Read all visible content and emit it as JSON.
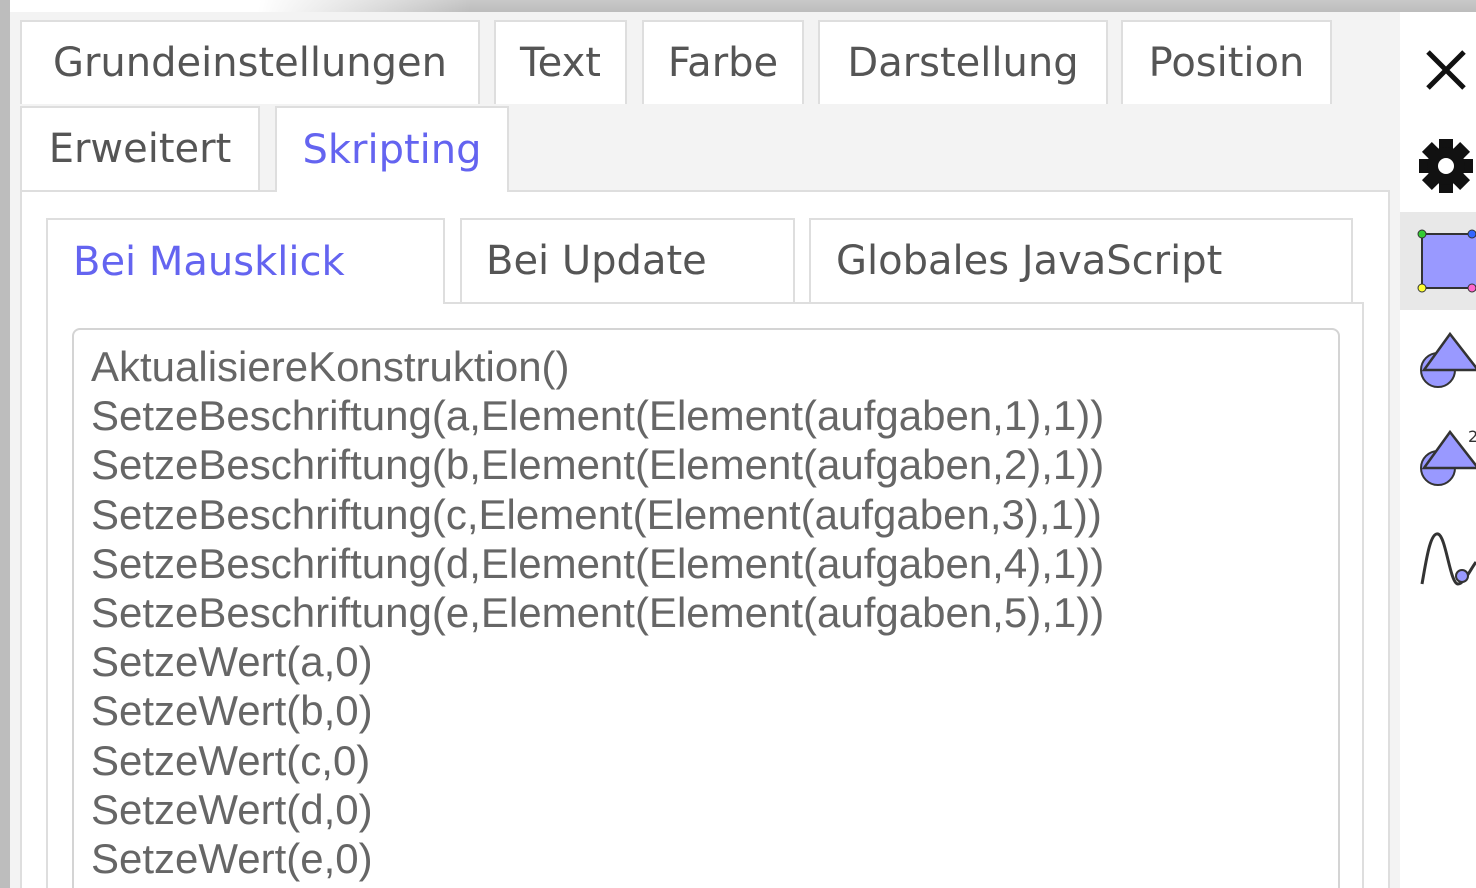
{
  "main_tabs": [
    {
      "label": "Grundeinstellungen"
    },
    {
      "label": "Text"
    },
    {
      "label": "Farbe"
    },
    {
      "label": "Darstellung"
    },
    {
      "label": "Position"
    },
    {
      "label": "Erweitert"
    },
    {
      "label": "Skripting"
    }
  ],
  "active_main_tab": "Skripting",
  "sub_tabs": [
    {
      "label": "Bei Mausklick"
    },
    {
      "label": "Bei Update"
    },
    {
      "label": "Globales JavaScript"
    }
  ],
  "active_sub_tab": "Bei Mausklick",
  "script_lines": [
    "AktualisiereKonstruktion()",
    "SetzeBeschriftung(a,Element(Element(aufgaben,1),1))",
    "SetzeBeschriftung(b,Element(Element(aufgaben,2),1))",
    "SetzeBeschriftung(c,Element(Element(aufgaben,3),1))",
    "SetzeBeschriftung(d,Element(Element(aufgaben,4),1))",
    "SetzeBeschriftung(e,Element(Element(aufgaben,5),1))",
    "SetzeWert(a,0)",
    "SetzeWert(b,0)",
    "SetzeWert(c,0)",
    "SetzeWert(d,0)",
    "SetzeWert(e,0)"
  ],
  "toolbar": {
    "icons": [
      "close-icon",
      "gear-icon",
      "polygon-tool-icon",
      "shapes-tool-icon",
      "shapes-squared-tool-icon",
      "function-graph-icon"
    ],
    "superscript": "2"
  },
  "colors": {
    "accent": "#6464f0",
    "tool_fill": "#9999ff",
    "tool_stroke": "#333333",
    "tab_border": "#dedede"
  }
}
